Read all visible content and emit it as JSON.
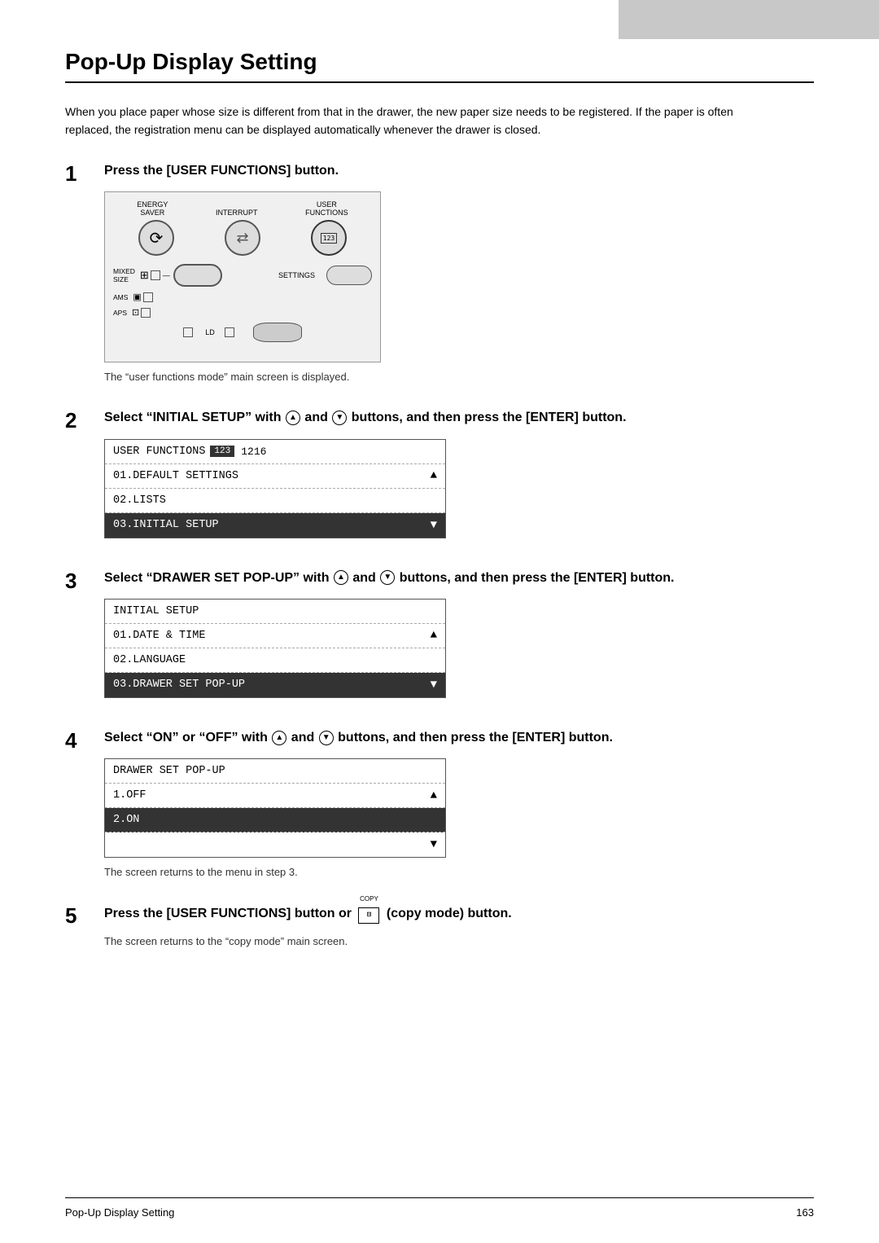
{
  "header": {
    "title": "Pop-Up Display Setting"
  },
  "intro": "When you place paper whose size is different from that in the drawer, the new paper size needs to be registered. If the paper is often replaced, the registration menu can be displayed automatically whenever the drawer is closed.",
  "steps": [
    {
      "number": "1",
      "heading": "Press the [USER FUNCTIONS] button.",
      "note": "The “user functions mode” main screen is displayed."
    },
    {
      "number": "2",
      "heading": "Select “INITIAL SETUP” with",
      "heading2": "buttons, and then press the [ENTER] button.",
      "lcd": {
        "header": "USER FUNCTIONS",
        "badge": "123",
        "page": "1216",
        "rows": [
          {
            "text": "01.DEFAULT SETTINGS",
            "arrow": "▲",
            "highlighted": false
          },
          {
            "text": "02.LISTS",
            "highlighted": false
          },
          {
            "text": "03.INITIAL SETUP",
            "arrow": "▼",
            "highlighted": true
          }
        ]
      }
    },
    {
      "number": "3",
      "heading": "Select “DRAWER SET POP-UP” with",
      "heading2": "buttons, and then press the [ENTER] button.",
      "lcd": {
        "header": "INITIAL SETUP",
        "rows": [
          {
            "text": "01.DATE & TIME",
            "arrow": "▲",
            "highlighted": false
          },
          {
            "text": "02.LANGUAGE",
            "highlighted": false
          },
          {
            "text": "03.DRAWER SET POP-UP",
            "arrow": "▼",
            "highlighted": true
          }
        ]
      }
    },
    {
      "number": "4",
      "heading": "Select “ON” or “OFF” with",
      "heading2": "buttons, and then press the [ENTER] button.",
      "lcd": {
        "header": "DRAWER SET POP-UP",
        "rows": [
          {
            "text": "1.OFF",
            "arrow": "▲",
            "highlighted": false
          },
          {
            "text": "2.ON",
            "highlighted": true
          },
          {
            "text": "",
            "arrow": "▼",
            "highlighted": false
          }
        ]
      },
      "note": "The screen returns to the menu in step 3."
    },
    {
      "number": "5",
      "heading_pre": "Press the [USER FUNCTIONS] button or",
      "heading_post": "(copy mode) button.",
      "note": "The screen returns to the “copy mode” main screen."
    }
  ],
  "footer": {
    "left": "Pop-Up Display Setting",
    "right": "163"
  },
  "labels": {
    "energy_saver": "ENERGY\nSAVER",
    "interrupt": "INTERRUPT",
    "user_functions": "USER\nFUNCTIONS",
    "mixed_size": "MIXED\nSIZE",
    "ams": "AMS",
    "aps": "APS",
    "settings": "SETTINGS",
    "ld": "LD",
    "copy": "COPY"
  }
}
